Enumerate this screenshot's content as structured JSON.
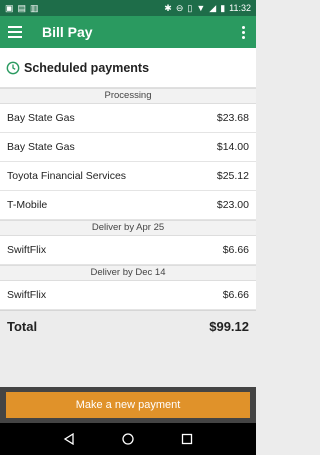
{
  "status_bar": {
    "time": "11:32"
  },
  "app_bar": {
    "title": "Bill Pay"
  },
  "section": {
    "title": "Scheduled payments"
  },
  "groups": [
    {
      "header": "Processing",
      "items": [
        {
          "payee": "Bay State Gas",
          "amount": "$23.68"
        },
        {
          "payee": "Bay State Gas",
          "amount": "$14.00"
        },
        {
          "payee": "Toyota Financial Services",
          "amount": "$25.12"
        },
        {
          "payee": "T-Mobile",
          "amount": "$23.00"
        }
      ]
    },
    {
      "header": "Deliver by Apr 25",
      "items": [
        {
          "payee": "SwiftFlix",
          "amount": "$6.66"
        }
      ]
    },
    {
      "header": "Deliver by Dec 14",
      "items": [
        {
          "payee": "SwiftFlix",
          "amount": "$6.66"
        }
      ]
    }
  ],
  "total": {
    "label": "Total",
    "value": "$99.12"
  },
  "actions": {
    "new_payment_label": "Make a new payment"
  },
  "colors": {
    "app_bar": "#2a9a60",
    "status_bar": "#1e6d49",
    "accent": "#e0922a"
  }
}
